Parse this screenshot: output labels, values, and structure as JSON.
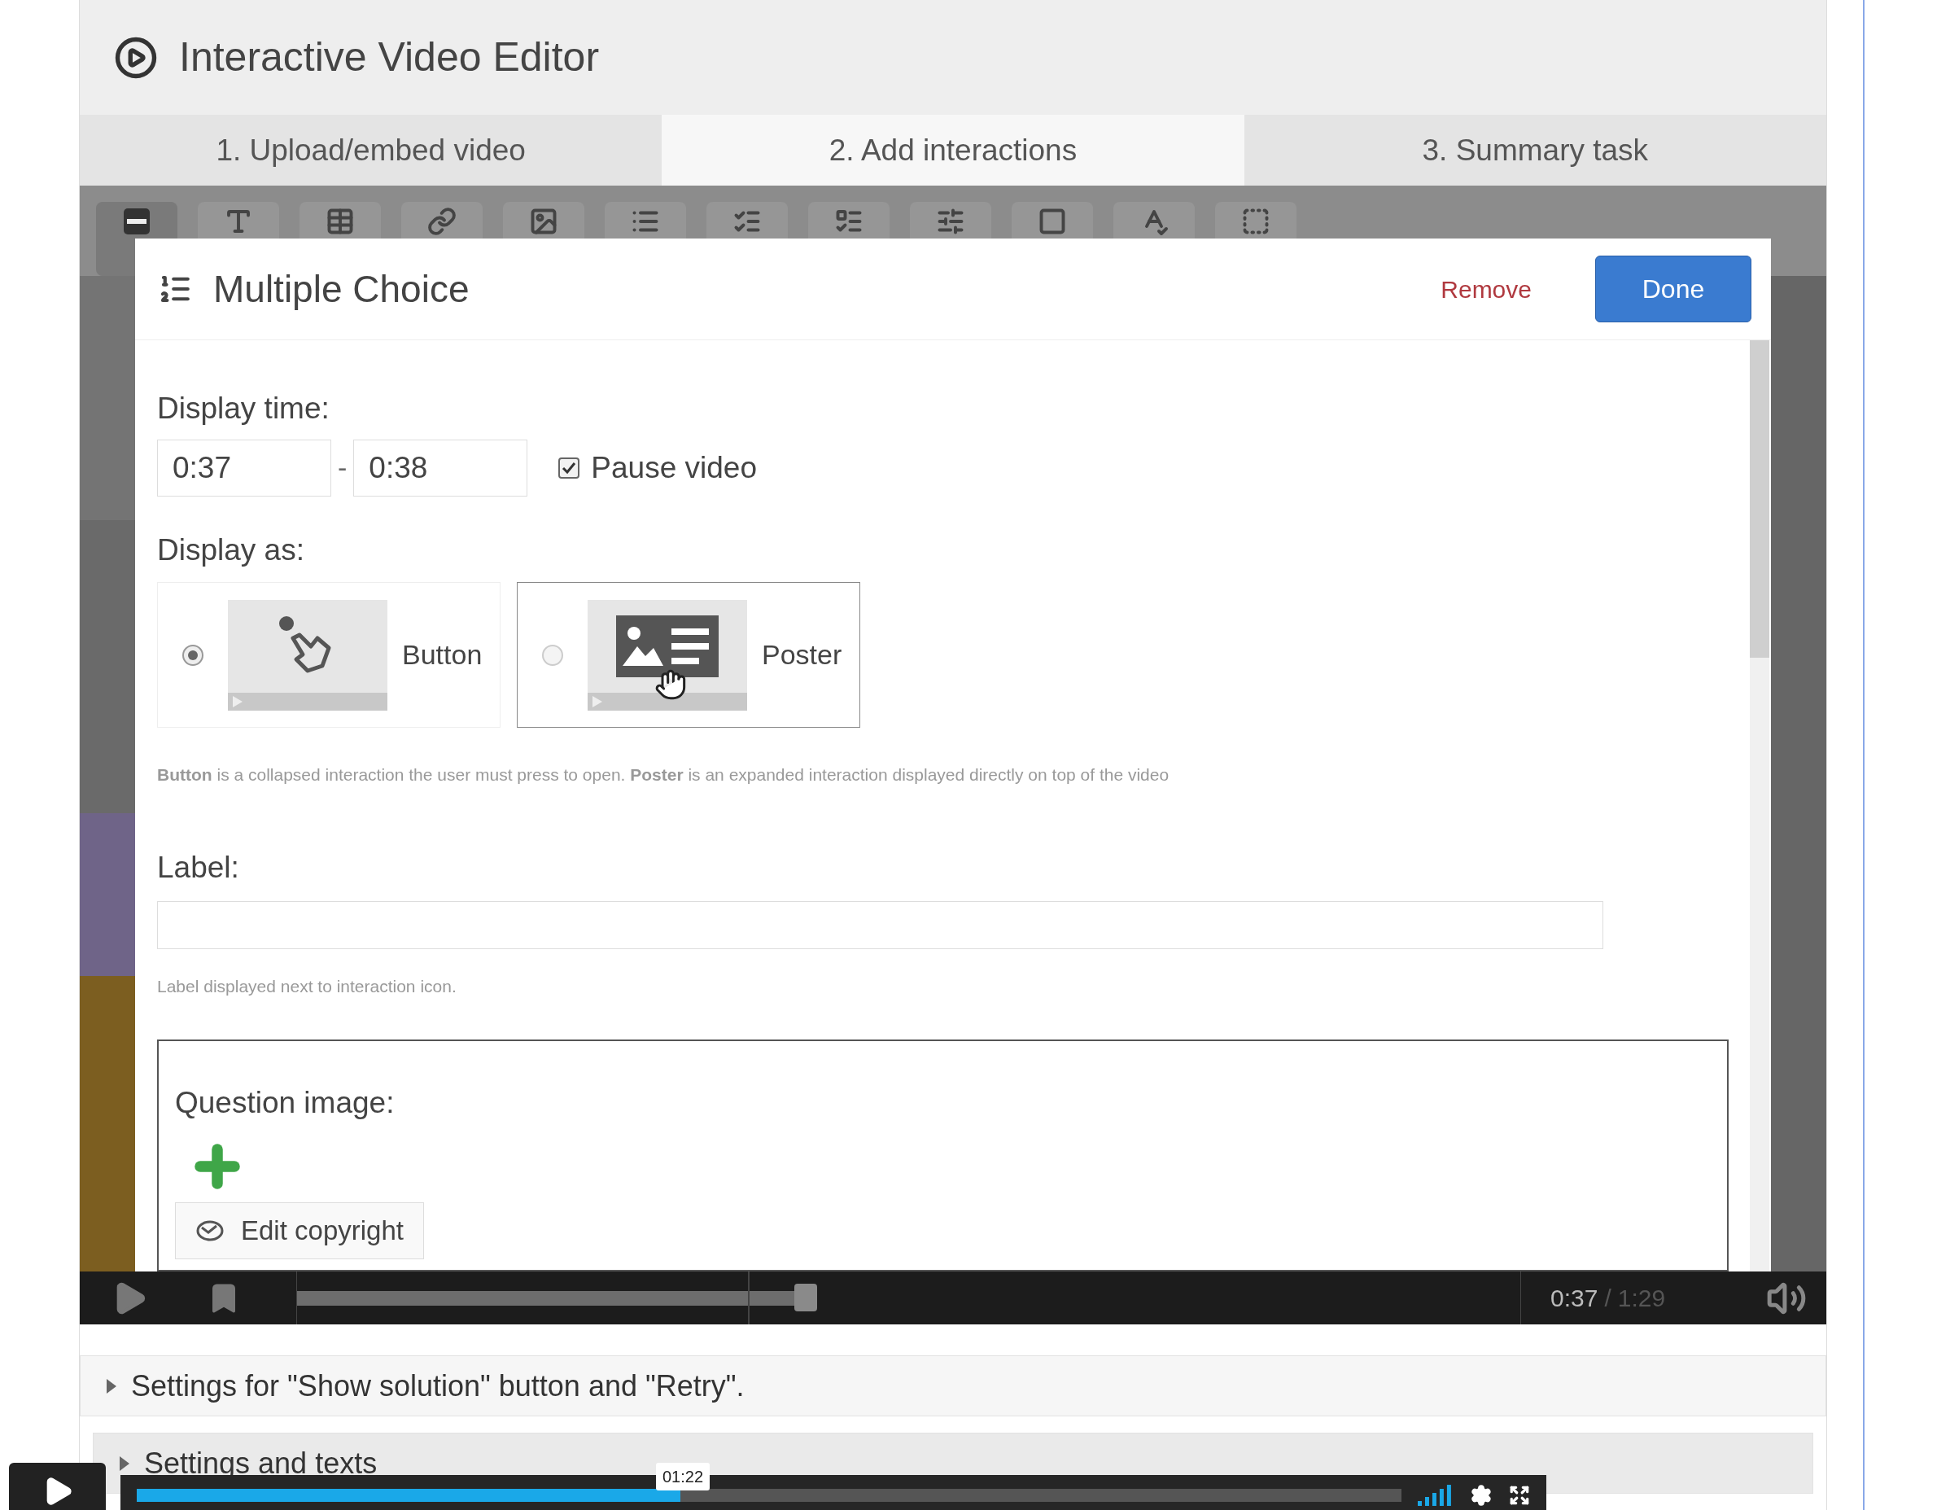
{
  "editor": {
    "title": "Interactive Video Editor"
  },
  "tabs": [
    {
      "label": "1. Upload/embed video",
      "selected": false
    },
    {
      "label": "2. Add interactions",
      "selected": true
    },
    {
      "label": "3. Summary task",
      "selected": false
    }
  ],
  "dialog": {
    "title": "Multiple Choice",
    "remove": "Remove",
    "done": "Done",
    "display_time_label": "Display time:",
    "start": "0:37",
    "separator": "-",
    "end": "0:38",
    "pause": {
      "label": "Pause video",
      "checked": true
    },
    "display_as_label": "Display as:",
    "display_options": [
      {
        "label": "Button",
        "kind": "button",
        "selected": true,
        "hovered": false
      },
      {
        "label": "Poster",
        "kind": "poster",
        "selected": false,
        "hovered": true
      }
    ],
    "display_hint": "**Button** is a collapsed interaction the user must press to open. **Poster** is an expanded interaction displayed directly on top of the video",
    "label_field": {
      "label": "Label:",
      "hint": "Label displayed next to interaction icon."
    },
    "question_image": {
      "label": "Question image:",
      "copyright_button": "Edit copyright"
    }
  },
  "player": {
    "current": "0:37",
    "separator": "/",
    "duration": "1:29",
    "level": 0.416
  },
  "sections": [
    {
      "label": "Settings for \"Show solution\" button and \"Retry\".",
      "expanded": false
    },
    {
      "label": "Settings and texts",
      "expanded": false
    }
  ],
  "bottom_player": {
    "level": 0.43,
    "tooltip": "01:22"
  }
}
